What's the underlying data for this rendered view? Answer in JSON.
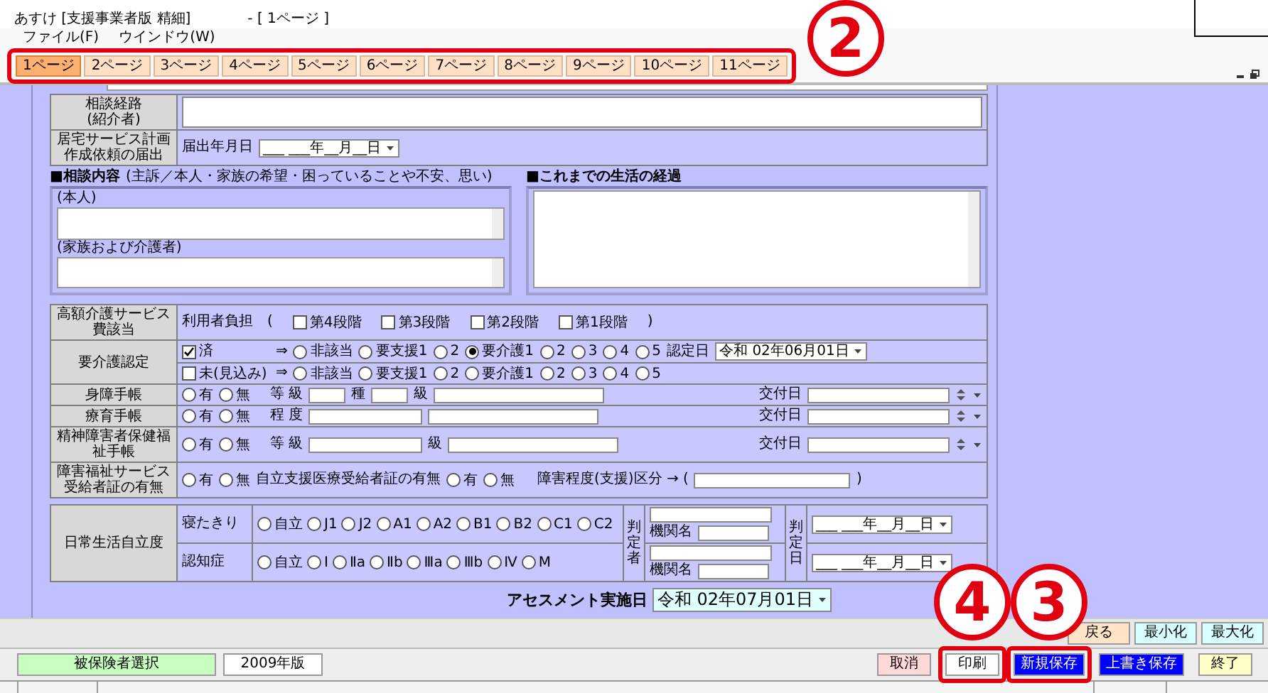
{
  "window": {
    "title": "あすけ [支援事業者版 精細]",
    "document": "- [ 1ページ ]"
  },
  "menu": [
    {
      "label": "ファイル(F)"
    },
    {
      "label": "ウインドウ(W)"
    }
  ],
  "tabs": {
    "highlighted": true,
    "callout": "2",
    "items": [
      {
        "label": "1ページ",
        "selected": true
      },
      {
        "label": "2ページ",
        "selected": false
      },
      {
        "label": "3ページ",
        "selected": false
      },
      {
        "label": "4ページ",
        "selected": false
      },
      {
        "label": "5ページ",
        "selected": false
      },
      {
        "label": "6ページ",
        "selected": false
      },
      {
        "label": "7ページ",
        "selected": false
      },
      {
        "label": "8ページ",
        "selected": false
      },
      {
        "label": "9ページ",
        "selected": false
      },
      {
        "label": "10ページ",
        "selected": false
      },
      {
        "label": "11ページ",
        "selected": false
      }
    ]
  },
  "consult_route": {
    "label": "相談経路",
    "note": "(紹介者)"
  },
  "home_plan": {
    "label": "居宅サービス計画作成依頼の届出",
    "field_label": "届出年月日",
    "date": "___ ___年__月__日"
  },
  "consult": {
    "title": "■相談内容",
    "note": "(主訴／本人・家族の希望・困っていることや不安、思い)",
    "self_label": "(本人)",
    "family_label": "(家族および介護者)"
  },
  "history": {
    "title": "■これまでの生活の経過"
  },
  "high_cost": {
    "label": "高額介護サービス費該当",
    "prefix": "利用者負担　(",
    "suffix": ")",
    "options": [
      {
        "label": "第4段階",
        "checked": false
      },
      {
        "label": "第3段階",
        "checked": false
      },
      {
        "label": "第2段階",
        "checked": false
      },
      {
        "label": "第1段階",
        "checked": false
      }
    ]
  },
  "care_cert": {
    "label": "要介護認定",
    "rows": [
      {
        "status": "済",
        "checked": true,
        "arrow": "⇒",
        "options": [
          {
            "label": "非該当",
            "selected": false
          },
          {
            "label": "要支援1",
            "selected": false
          },
          {
            "label": "2",
            "selected": false
          },
          {
            "label": "要介護1",
            "selected": true
          },
          {
            "label": "2",
            "selected": false
          },
          {
            "label": "3",
            "selected": false
          },
          {
            "label": "4",
            "selected": false
          },
          {
            "label": "5",
            "selected": false
          }
        ],
        "date_label": "認定日",
        "date": "令和 02年06月01日"
      },
      {
        "status": "未(見込み)",
        "checked": false,
        "arrow": "⇒",
        "options": [
          {
            "label": "非該当",
            "selected": false
          },
          {
            "label": "要支援1",
            "selected": false
          },
          {
            "label": "2",
            "selected": false
          },
          {
            "label": "要介護1",
            "selected": false
          },
          {
            "label": "2",
            "selected": false
          },
          {
            "label": "3",
            "selected": false
          },
          {
            "label": "4",
            "selected": false
          },
          {
            "label": "5",
            "selected": false
          }
        ]
      }
    ]
  },
  "handbooks": [
    {
      "label": "身障手帳",
      "options": [
        {
          "label": "有",
          "selected": false
        },
        {
          "label": "無",
          "selected": false
        }
      ],
      "parts": [
        {
          "kind": "text",
          "text": "等 級"
        },
        {
          "kind": "short_input"
        },
        {
          "kind": "text",
          "text": "種"
        },
        {
          "kind": "short_input"
        },
        {
          "kind": "text",
          "text": "級"
        },
        {
          "kind": "long_input"
        }
      ],
      "issue_label": "交付日"
    },
    {
      "label": "療育手帳",
      "options": [
        {
          "label": "有",
          "selected": false
        },
        {
          "label": "無",
          "selected": false
        }
      ],
      "parts": [
        {
          "kind": "text",
          "text": "程 度"
        },
        {
          "kind": "medium_input"
        },
        {
          "kind": "long_input"
        }
      ],
      "issue_label": "交付日"
    },
    {
      "label": "精神障害者保健福祉手帳",
      "options": [
        {
          "label": "有",
          "selected": false
        },
        {
          "label": "無",
          "selected": false
        }
      ],
      "parts": [
        {
          "kind": "text",
          "text": "等 級"
        },
        {
          "kind": "medium_input"
        },
        {
          "kind": "text",
          "text": "級"
        },
        {
          "kind": "long_input"
        }
      ],
      "issue_label": "交付日"
    }
  ],
  "disability": {
    "label": "障害福祉サービス受給者証の有無",
    "options": [
      {
        "label": "有",
        "selected": false
      },
      {
        "label": "無",
        "selected": false
      }
    ],
    "label2": "自立支援医療受給者証の有無",
    "options2": [
      {
        "label": "有",
        "selected": false
      },
      {
        "label": "無",
        "selected": false
      }
    ],
    "level_label": "障害程度(支援)区分 → (",
    "level_suffix": ")"
  },
  "daily_life": {
    "label": "日常生活自立度",
    "judge_label": "判定者",
    "date_label": "判定日",
    "rows": [
      {
        "label": "寝たきり",
        "agency_label": "機関名",
        "date": "___ ___年__月__日",
        "options": [
          {
            "label": "自立",
            "selected": false
          },
          {
            "label": "J1",
            "selected": false
          },
          {
            "label": "J2",
            "selected": false
          },
          {
            "label": "A1",
            "selected": false
          },
          {
            "label": "A2",
            "selected": false
          },
          {
            "label": "B1",
            "selected": false
          },
          {
            "label": "B2",
            "selected": false
          },
          {
            "label": "C1",
            "selected": false
          },
          {
            "label": "C2",
            "selected": false
          }
        ]
      },
      {
        "label": "認知症",
        "agency_label": "機関名",
        "date": "___ ___年__月__日",
        "options": [
          {
            "label": "自立",
            "selected": false
          },
          {
            "label": "Ⅰ",
            "selected": false
          },
          {
            "label": "Ⅱa",
            "selected": false
          },
          {
            "label": "Ⅱb",
            "selected": false
          },
          {
            "label": "Ⅲa",
            "selected": false
          },
          {
            "label": "Ⅲb",
            "selected": false
          },
          {
            "label": "Ⅳ",
            "selected": false
          },
          {
            "label": "M",
            "selected": false
          }
        ]
      }
    ]
  },
  "assessment": {
    "label": "アセスメント実施日",
    "date": "令和 02年07月01日"
  },
  "window_buttons": [
    {
      "label": "戻る",
      "color": "#ffe4c8"
    },
    {
      "label": "最小化",
      "color": "#d8ffff"
    },
    {
      "label": "最大化",
      "color": "#d8ffff"
    }
  ],
  "footer_left": [
    {
      "label": "被保険者選択",
      "color": "#c8ffc0"
    },
    {
      "label": "2009年版",
      "color": "#ffffff"
    }
  ],
  "footer_right": [
    {
      "label": "取消",
      "color": "#ffd8d8",
      "highlighted": false
    },
    {
      "label": "印刷",
      "color": "#ffffff",
      "highlighted": true,
      "callout": "4"
    },
    {
      "label": "新規保存",
      "color": "#0000ff",
      "highlighted": true,
      "callout": "3"
    },
    {
      "label": "上書き保存",
      "color": "#0000ff",
      "highlighted": false
    },
    {
      "label": "終了",
      "color": "#ffffc8",
      "highlighted": false
    }
  ]
}
